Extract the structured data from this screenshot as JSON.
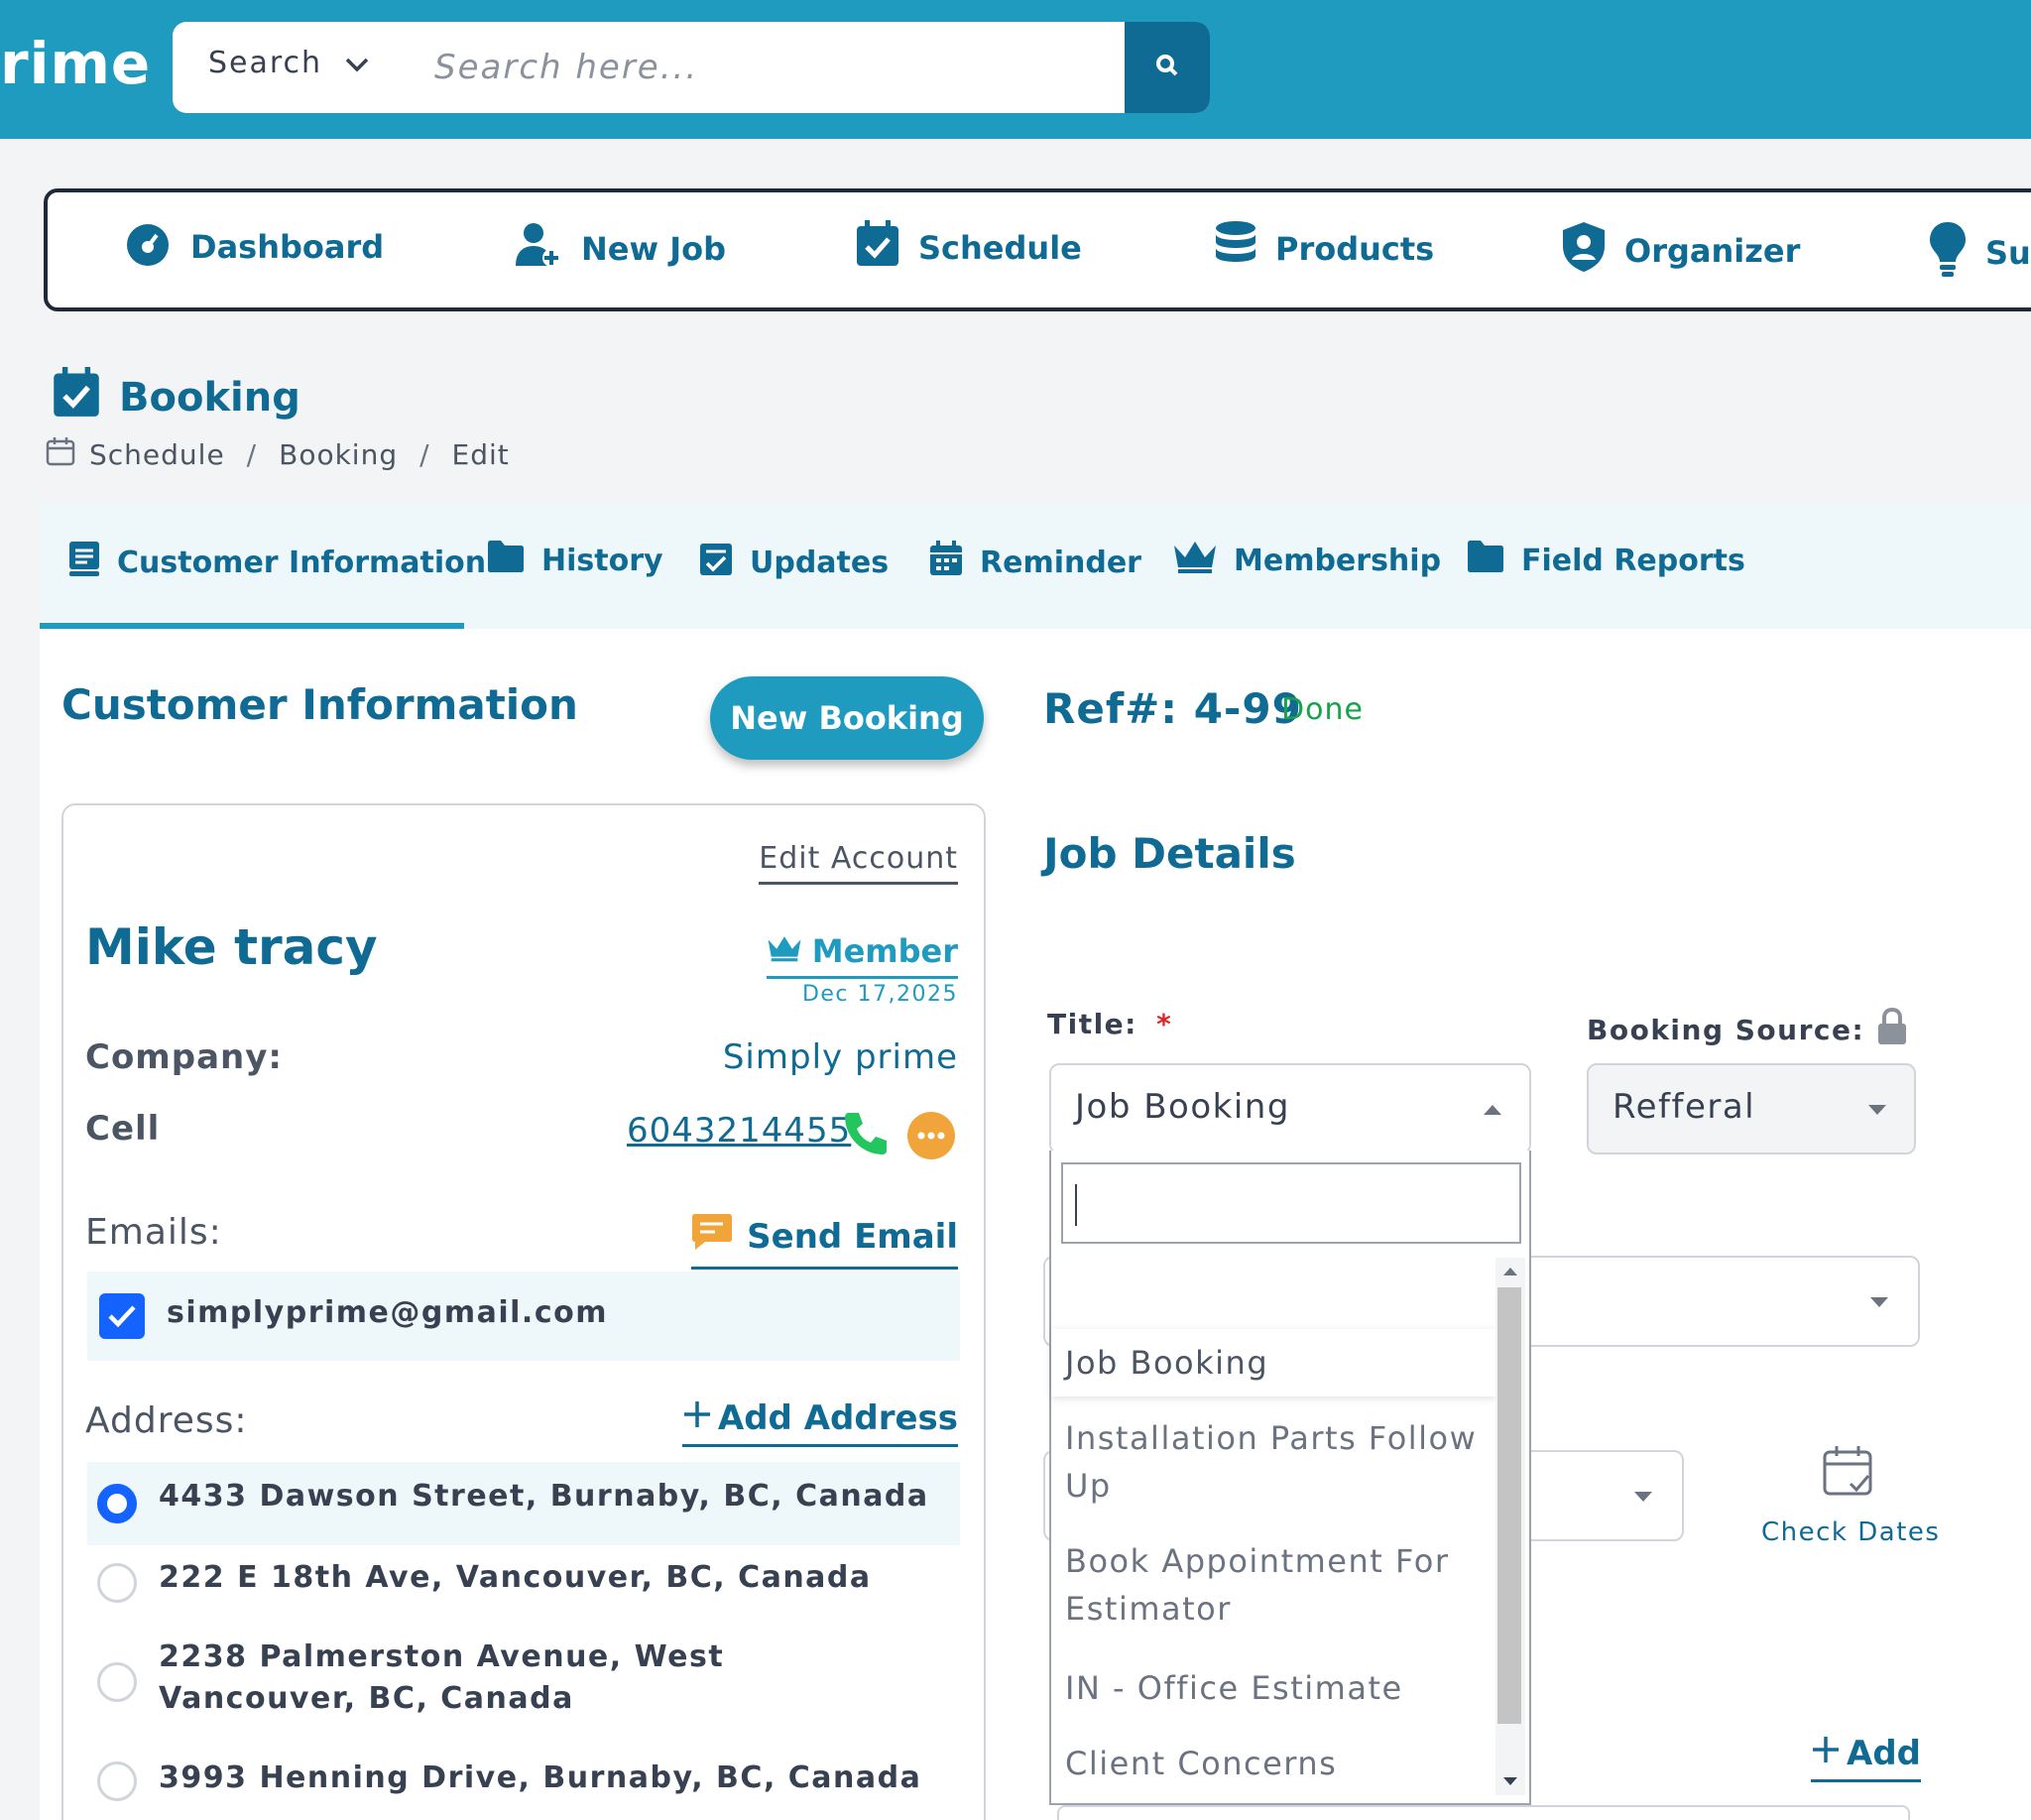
{
  "app": {
    "brand": "rime"
  },
  "search": {
    "type_label": "Search",
    "placeholder": "Search here..."
  },
  "nav": {
    "items": [
      {
        "label": "Dashboard",
        "icon": "gauge-icon"
      },
      {
        "label": "New Job",
        "icon": "user-plus-icon"
      },
      {
        "label": "Schedule",
        "icon": "calendar-check-icon"
      },
      {
        "label": "Products",
        "icon": "database-icon"
      },
      {
        "label": "Organizer",
        "icon": "user-shield-icon"
      },
      {
        "label": "Su",
        "icon": "lightbulb-icon"
      }
    ]
  },
  "page": {
    "title": "Booking",
    "breadcrumb": [
      "Schedule",
      "Booking",
      "Edit"
    ]
  },
  "tabs": [
    {
      "label": "Customer Information",
      "icon": "id-card-icon",
      "active": true
    },
    {
      "label": "History",
      "icon": "folder-icon"
    },
    {
      "label": "Updates",
      "icon": "clipboard-check-icon"
    },
    {
      "label": "Reminder",
      "icon": "calendar-icon"
    },
    {
      "label": "Membership",
      "icon": "crown-icon"
    },
    {
      "label": "Field Reports",
      "icon": "folder-icon"
    }
  ],
  "customer": {
    "section_title": "Customer Information",
    "new_booking_label": "New Booking",
    "edit_account_label": "Edit Account",
    "name": "Mike tracy",
    "member_label": "Member",
    "member_date": "Dec 17,2025",
    "company_label": "Company:",
    "company_value": "Simply prime",
    "cell_label": "Cell",
    "cell_value": "6043214455",
    "emails_label": "Emails:",
    "send_email_label": "Send Email",
    "email": "simplyprime@gmail.com",
    "address_label": "Address:",
    "add_address_label": "Add Address",
    "addresses": [
      {
        "text": "4433 Dawson Street, Burnaby, BC, Canada",
        "selected": true
      },
      {
        "text": "222 E 18th Ave, Vancouver, BC, Canada",
        "selected": false
      },
      {
        "text": "2238 Palmerston Avenue, West Vancouver, BC, Canada",
        "selected": false
      },
      {
        "text": "3993 Henning Drive, Burnaby, BC, Canada",
        "selected": false
      }
    ]
  },
  "job": {
    "ref_label": "Ref#: 4-99",
    "status": "Done",
    "section_title": "Job Details",
    "title_label": "Title:",
    "required_mark": "*",
    "title_value": "Job Booking",
    "booking_source_label": "Booking Source:",
    "booking_source_value": "Refferal",
    "check_dates_label": "Check Dates",
    "add_label": "Add",
    "dropdown_options": [
      "Job Booking",
      "Installation Parts Follow Up",
      "Book Appointment For Estimator",
      "IN - Office Estimate",
      "Client Concerns"
    ]
  },
  "colors": {
    "brand": "#1e9bbf",
    "brand_dark": "#0f6a94",
    "status_done": "#16a34a",
    "phone_green": "#22c55e",
    "chat_orange": "#f0a43a"
  }
}
